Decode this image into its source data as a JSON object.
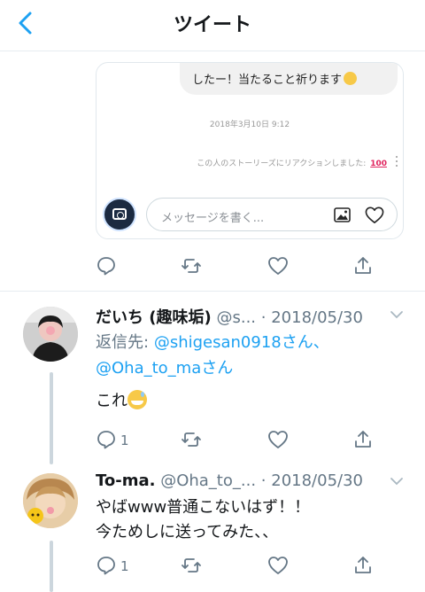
{
  "header": {
    "title": "ツイート"
  },
  "embed": {
    "bubble_text": "したー！当たること祈ります",
    "timestamp": "2018年3月10日 9:12",
    "reaction_text": "この人のストーリーズにリアクションしました:",
    "reaction_emoji": "100",
    "message_placeholder": "メッセージを書く..."
  },
  "tweets": [
    {
      "name": "だいち (趣味垢)",
      "handle": "@s...",
      "separator": "·",
      "date": "2018/05/30",
      "reply_label": "返信先:",
      "mention1": "@shigesan0918さん、",
      "mention2": "@Oha_to_maさん",
      "text": "これ",
      "reply_count": "1"
    },
    {
      "name": "To-ma.",
      "handle": "@Oha_to_...",
      "separator": "·",
      "date": "2018/05/30",
      "text_line1": "やばwww普通こないはず！！",
      "text_line2": "今ためしに送ってみた、、",
      "reply_count": "1"
    }
  ],
  "colors": {
    "accent": "#1da1f2",
    "muted": "#657786",
    "divider": "#e6ecf0"
  }
}
